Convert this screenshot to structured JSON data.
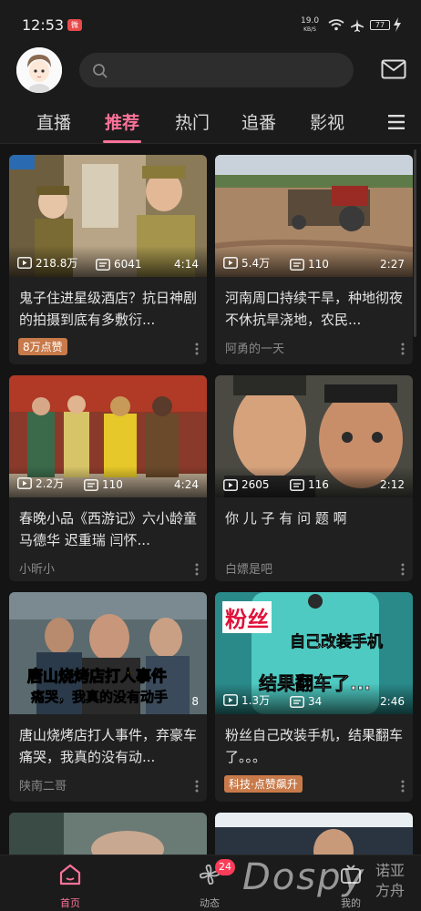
{
  "status": {
    "time": "12:53",
    "app_badge": "微",
    "speed_value": "19.0",
    "speed_unit": "KB/S",
    "battery": "77"
  },
  "header": {
    "search_placeholder": ""
  },
  "tabs": [
    {
      "label": "直播"
    },
    {
      "label": "推荐"
    },
    {
      "label": "热门"
    },
    {
      "label": "追番"
    },
    {
      "label": "影视"
    }
  ],
  "cards": [
    {
      "views": "218.8万",
      "danmaku": "6041",
      "duration": "4:14",
      "title": "鬼子住进星级酒店？抗日神剧的拍摄到底有多敷衍...",
      "badge": "8万点赞",
      "author": ""
    },
    {
      "views": "5.4万",
      "danmaku": "110",
      "duration": "2:27",
      "title": "河南周口持续干旱，种地彻夜不休抗旱浇地，农民...",
      "badge": "",
      "author": "阿勇的一天"
    },
    {
      "views": "2.2万",
      "danmaku": "110",
      "duration": "4:24",
      "title": "春晚小品《西游记》六小龄童 马德华 迟重瑞 闫怀...",
      "badge": "",
      "author": "小昕小"
    },
    {
      "views": "2605",
      "danmaku": "116",
      "duration": "2:12",
      "title": "你 儿 子 有 问 题 啊",
      "badge": "",
      "author": "白嫖是吧"
    },
    {
      "views": "",
      "danmaku": "",
      "duration": "8",
      "title": "唐山烧烤店打人事件，弃豪车痛哭，我真的没有动...",
      "badge": "",
      "author": "陕南二哥",
      "overlay_1": "唐山烧烤店打人事件",
      "overlay_2": "痛哭，我真的没有动手"
    },
    {
      "views": "1.3万",
      "danmaku": "34",
      "duration": "2:46",
      "title": "粉丝自己改装手机，结果翻车了。。。",
      "badge": "科技·点赞飙升",
      "author": "",
      "overlay_1": "粉丝",
      "overlay_2": "自己改装手机",
      "overlay_3": "结果翻车了..."
    }
  ],
  "bottomnav": {
    "home": "首页",
    "dynamic": "动态",
    "mine": "我的",
    "notif_count": "24"
  },
  "watermark": {
    "brand": "Dospy",
    "cn_1": "诺亚",
    "cn_2": "方舟"
  }
}
